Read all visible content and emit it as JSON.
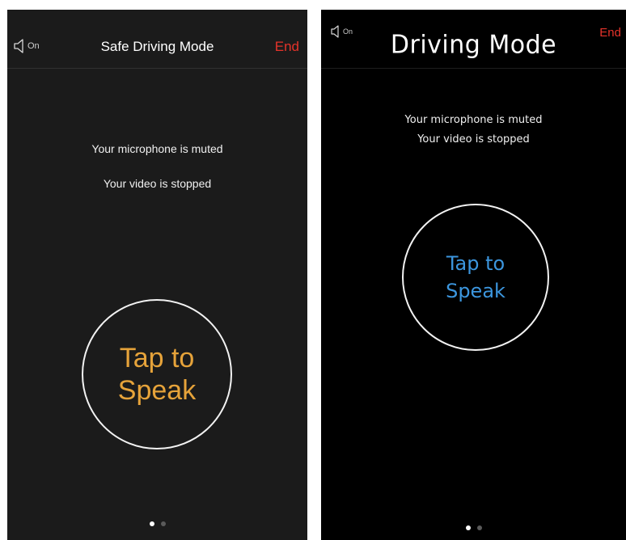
{
  "screens": [
    {
      "speaker_label": "On",
      "title": "Safe Driving Mode",
      "end_label": "End",
      "mic_status": "Your microphone is muted",
      "video_status": "Your video is stopped",
      "tap_line1": "Tap to",
      "tap_line2": "Speak",
      "speaker_icon": "speaker-icon",
      "accent_color": "#e6a33a",
      "end_color": "#e5332a",
      "page_dots": {
        "count": 2,
        "active": 1
      }
    },
    {
      "speaker_label": "On",
      "title": "Driving Mode",
      "end_label": "End",
      "mic_status": "Your microphone is muted",
      "video_status": "Your video is stopped",
      "tap_line1": "Tap to",
      "tap_line2": "Speak",
      "speaker_icon": "speaker-icon",
      "accent_color": "#3c96de",
      "end_color": "#e5332a",
      "page_dots": {
        "count": 2,
        "active": 1
      }
    }
  ]
}
